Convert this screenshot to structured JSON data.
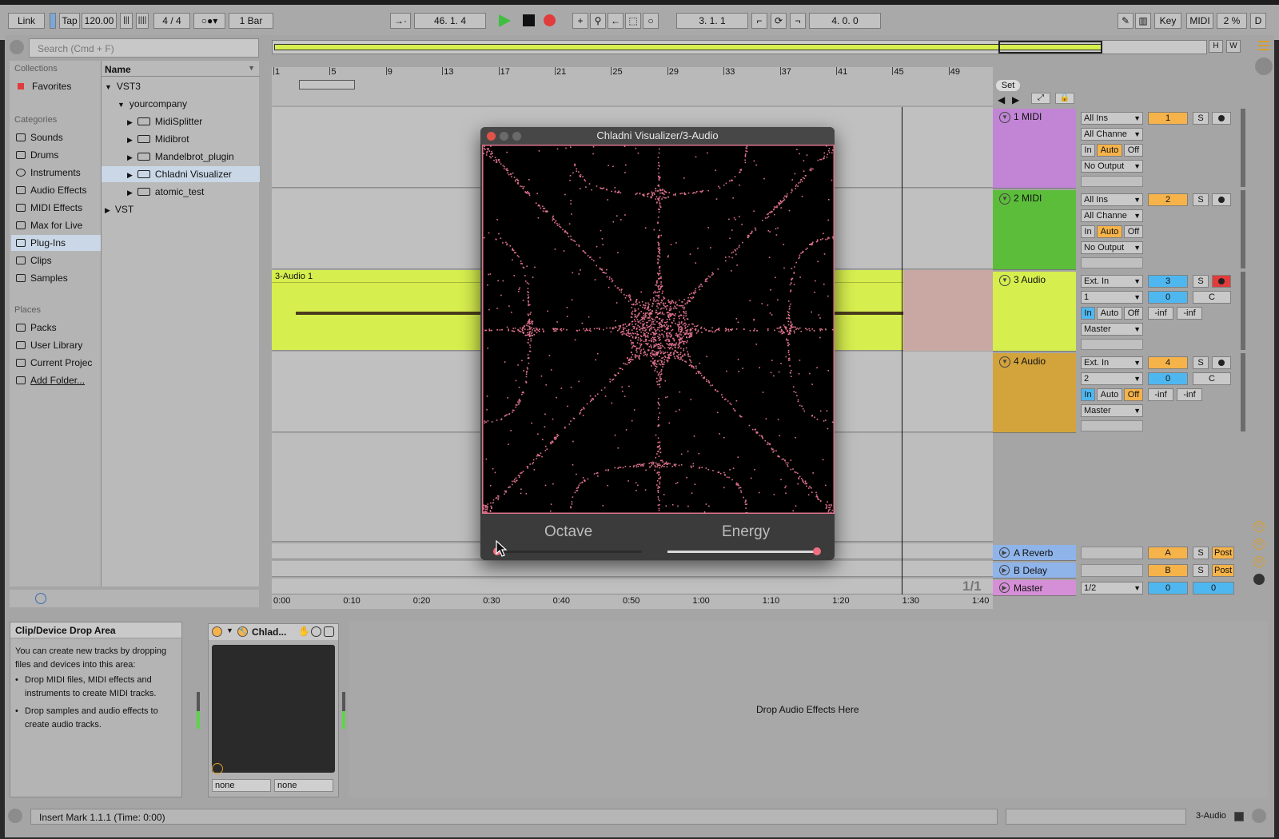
{
  "transport": {
    "link": "Link",
    "tap": "Tap",
    "tempo": "120.00",
    "signature_num": "4",
    "signature_den": "4",
    "quantize": "1 Bar",
    "position": "46.  1.  4",
    "loop_start": "3.  1.  1",
    "loop_length": "4.  0.  0",
    "key": "Key",
    "midi": "MIDI",
    "cpu": "2 %",
    "d": "D"
  },
  "browser": {
    "search_placeholder": "Search (Cmd + F)",
    "collections_header": "Collections",
    "favorites": "Favorites",
    "categories_header": "Categories",
    "categories": [
      "Sounds",
      "Drums",
      "Instruments",
      "Audio Effects",
      "MIDI Effects",
      "Max for Live",
      "Plug-Ins",
      "Clips",
      "Samples"
    ],
    "places_header": "Places",
    "places": [
      "Packs",
      "User Library",
      "Current Projec",
      "Add Folder..."
    ],
    "name_header": "Name",
    "tree": {
      "vst3": "VST3",
      "yourcompany": "yourcompany",
      "plugins": [
        "MidiSplitter",
        "Midibrot",
        "Mandelbrot_plugin",
        "Chladni Visualizer",
        "atomic_test"
      ],
      "vst": "VST"
    }
  },
  "ruler": {
    "bars": [
      "1",
      "5",
      "9",
      "13",
      "17",
      "21",
      "25",
      "29",
      "33",
      "37",
      "41",
      "45",
      "49"
    ],
    "times": [
      "0:00",
      "0:10",
      "0:20",
      "0:30",
      "0:40",
      "0:50",
      "1:00",
      "1:10",
      "1:20",
      "1:30",
      "1:40"
    ],
    "set_label": "Set",
    "page": "1/1"
  },
  "clip": {
    "name": "3-Audio 1"
  },
  "tracks": [
    {
      "name": "1 MIDI",
      "color": "#c285d6",
      "input": "All Ins",
      "channel": "All Channe",
      "output": "No Output",
      "num": "1"
    },
    {
      "name": "2 MIDI",
      "color": "#5cbd3a",
      "input": "All Ins",
      "channel": "All Channe",
      "output": "No Output",
      "num": "2"
    },
    {
      "name": "3 Audio",
      "color": "#d6ee4e",
      "input": "Ext. In",
      "channel": "1",
      "output": "Master",
      "num": "3",
      "vol": "0",
      "pan": "C",
      "meter_l": "-inf",
      "meter_r": "-inf"
    },
    {
      "name": "4 Audio",
      "color": "#d3a33c",
      "input": "Ext. In",
      "channel": "2",
      "output": "Master",
      "num": "4",
      "vol": "0",
      "pan": "C",
      "meter_l": "-inf",
      "meter_r": "-inf"
    }
  ],
  "monitor": {
    "in": "In",
    "auto": "Auto",
    "off": "Off"
  },
  "solo": "S",
  "returns": [
    {
      "name": "A Reverb",
      "letter": "A",
      "post": "Post"
    },
    {
      "name": "B Delay",
      "letter": "B",
      "post": "Post"
    }
  ],
  "master": {
    "name": "Master",
    "cue": "1/2",
    "vol": "0",
    "vol2": "0"
  },
  "plugin_window": {
    "title": "Chladni Visualizer/3-Audio",
    "octave_label": "Octave",
    "energy_label": "Energy",
    "octave_value": 0.0,
    "energy_value": 1.0
  },
  "device_view": {
    "drop_title": "Clip/Device Drop Area",
    "drop_text": "You can create new tracks by dropping files and devices into this area:",
    "bullets": [
      "Drop MIDI files, MIDI effects and instruments to create MIDI tracks.",
      "Drop samples and audio effects to create audio tracks."
    ],
    "device_name": "Chlad...",
    "param1": "none",
    "param2": "none",
    "drop_effects": "Drop Audio Effects Here"
  },
  "status": {
    "message": "Insert Mark 1.1.1 (Time: 0:00)",
    "track": "3-Audio"
  },
  "colors": {
    "accent": "#f5b34a",
    "selected": "#c9d7e6",
    "record": "#e23b3b",
    "play": "#3fbf3f",
    "particle": "#e0738d"
  }
}
